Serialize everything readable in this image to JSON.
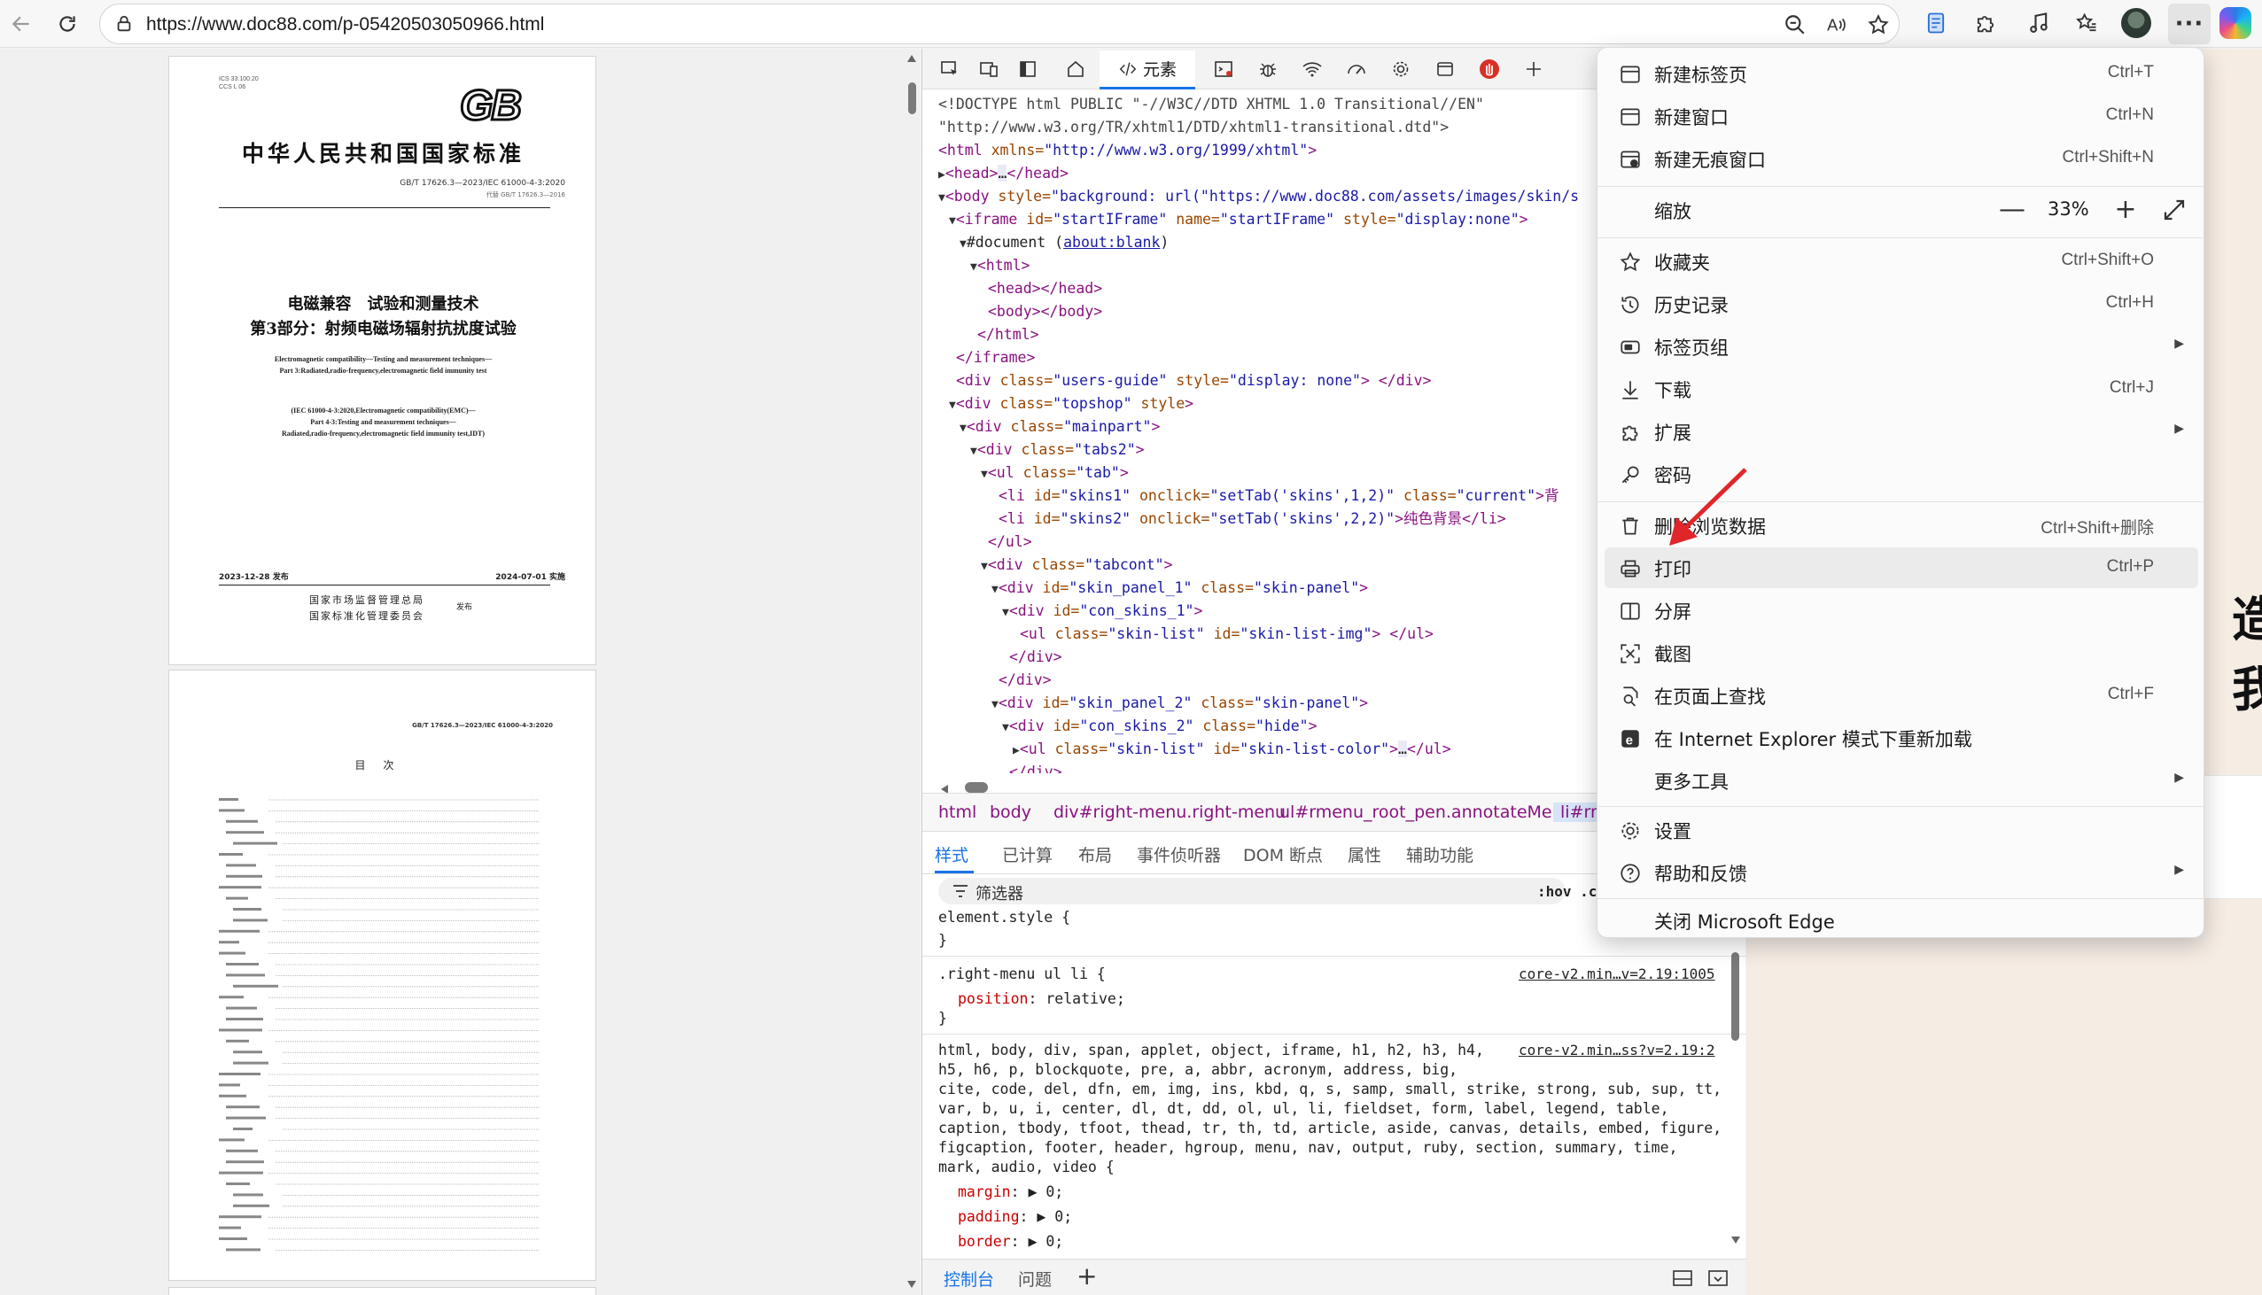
{
  "browser": {
    "url": "https://www.doc88.com/p-05420503050966.html"
  },
  "document": {
    "page1": {
      "ics_line": "ICS 33.100.20",
      "ccs_line": "CCS L 06",
      "logo": "GB",
      "nation": "中华人民共和国国家标准",
      "code": "GB/T 17626.3—2023/IEC 61000-4-3:2020",
      "replaces": "代替 GB/T 17626.3—2016",
      "title1": "电磁兼容　试验和测量技术",
      "title2": "第3部分：射频电磁场辐射抗扰度试验",
      "en1": "Electromagnetic compatibility—Testing and measurement techniques—",
      "en2": "Part 3:Radiated,radio-frequency,electromagnetic field immunity test",
      "en3": "(IEC 61000-4-3:2020,Electromagnetic compatibility(EMC)—",
      "en4": "Part 4-3:Testing and measurement techniques—",
      "en5": "Radiated,radio-frequency,electromagnetic field immunity test,IDT)",
      "pub_date": "2023-12-28 发布",
      "impl_date": "2024-07-01 实施",
      "pub_org1": "国家市场监督管理总局",
      "pub_org2": "国家标准化管理委员会",
      "pub_word": "发布"
    },
    "page2": {
      "code": "GB/T 17626.3—2023/IEC 61000-4-3:2020",
      "toc_title": "目次"
    }
  },
  "devtools": {
    "elements_tab": "元素",
    "tree": {
      "doctype1": "<!DOCTYPE html PUBLIC \"-//W3C//DTD XHTML 1.0 Transitional//EN\"",
      "doctype2": "\"http://www.w3.org/TR/xhtml1/DTD/xhtml1-transitional.dtd\">",
      "html_tag": "<html",
      "html_attr": " xmlns=",
      "html_val": "\"http://www.w3.org/1999/xhtml\"",
      "html_close": ">",
      "head_line": "<head>",
      "head_dots": "…",
      "head_close": "</head>",
      "body_tag": "<body",
      "body_attr": " style=",
      "body_val": "\"background: url(\"https://www.doc88.com/assets/images/skin/s",
      "iframe_tag": "<iframe",
      "iframe_a1": " id=",
      "iframe_v1": "\"startIFrame\"",
      "iframe_a2": " name=",
      "iframe_v2": "\"startIFrame\"",
      "iframe_a3": " style=",
      "iframe_v3": "\"display:none\"",
      "iframe_end": ">",
      "document_text": "#document (",
      "about_blank": "about:blank",
      "document_end": ")",
      "inner_html": "<html>",
      "inner_head": "<head></head>",
      "inner_body": "<body></body>",
      "inner_html_close": "</html>",
      "iframe_close": "</iframe>",
      "div1_tag": "<div",
      "div1_a": " class=",
      "div1_v": "\"users-guide\"",
      "div1_a2": " style=",
      "div1_v2": "\"display: none\"",
      "div1_end": "> </div>",
      "div2_tag": "<div",
      "div2_a": " class=",
      "div2_v": "\"topshop\"",
      "div2_a2": " style",
      "div2_end": ">",
      "div3_tag": "<div",
      "div3_a": " class=",
      "div3_v": "\"mainpart\"",
      "div3_end": ">",
      "div4_tag": "<div",
      "div4_a": " class=",
      "div4_v": "\"tabs2\"",
      "div4_end": ">",
      "ul_tag": "<ul",
      "ul_a": " class=",
      "ul_v": "\"tab\"",
      "ul_end": ">",
      "li1_tag": "<li",
      "li1_a1": " id=",
      "li1_v1": "\"skins1\"",
      "li1_a2": " onclick=",
      "li1_v2": "\"setTab('skins',1,2)\"",
      "li1_a3": " class=",
      "li1_v3": "\"current\"",
      "li1_end": ">背",
      "li2_tag": "<li",
      "li2_a1": " id=",
      "li2_v1": "\"skins2\"",
      "li2_a2": " onclick=",
      "li2_v2": "\"setTab('skins',2,2)\"",
      "li2_end": ">纯色背景</li>",
      "ul_close": "</ul>",
      "tabcont_tag": "<div",
      "tabcont_a": " class=",
      "tabcont_v": "\"tabcont\"",
      "tabcont_end": ">",
      "sp1_tag": "<div",
      "sp1_a1": " id=",
      "sp1_v1": "\"skin_panel_1\"",
      "sp1_a2": " class=",
      "sp1_v2": "\"skin-panel\"",
      "sp1_end": ">",
      "cs1_tag": "<div",
      "cs1_a1": " id=",
      "cs1_v1": "\"con_skins_1\"",
      "cs1_end": ">",
      "ul2_tag": "<ul",
      "ul2_a1": " class=",
      "ul2_v1": "\"skin-list\"",
      "ul2_a2": " id=",
      "ul2_v2": "\"skin-list-img\"",
      "ul2_end": "> </ul>",
      "div_close1": "</div>",
      "div_close2": "</div>",
      "sp2_tag": "<div",
      "sp2_a1": " id=",
      "sp2_v1": "\"skin_panel_2\"",
      "sp2_a2": " class=",
      "sp2_v2": "\"skin-panel\"",
      "sp2_end": ">",
      "cs2_tag": "<div",
      "cs2_a1": " id=",
      "cs2_v1": "\"con_skins_2\"",
      "cs2_a2": " class=",
      "cs2_v2": "\"hide\"",
      "cs2_end": ">",
      "ul3_tag": "<ul",
      "ul3_a1": " class=",
      "ul3_v1": "\"skin-list\"",
      "ul3_a2": " id=",
      "ul3_v2": "\"skin-list-color\"",
      "ul3_dots": "…",
      "ul3_end": "</ul>",
      "last_div": "</div>"
    },
    "breadcrumb": [
      "html",
      "body",
      "div#right-menu.right-menu",
      "ul#rmenu_root_pen.annotateMenu",
      "li#rm"
    ],
    "subtabs": [
      "样式",
      "已计算",
      "布局",
      "事件侦听器",
      "DOM 断点",
      "属性",
      "辅助功能"
    ],
    "filter_placeholder": "筛选器",
    "hov": ":hov .cls",
    "styles": {
      "r1_selector": "element.style {",
      "r1_close": "}",
      "r2_selector": ".right-menu ul li {",
      "r2_source": "core-v2.min…v=2.19:1005",
      "r2_prop": "position",
      "r2_value": ": relative;",
      "r2_close": "}",
      "r3_line1": "html, body, div, span, applet, object, iframe, h1, h2, h3, h4,",
      "r3_source": "core-v2.min…ss?v=2.19:2",
      "r3_line2": "h5, h6, p, blockquote, pre, a, abbr, acronym, address, big,",
      "r3_line3": "cite, code, del, dfn, em, img, ins, kbd, q, s, samp, small, strike, strong, sub, sup, tt,",
      "r3_line4": "var, b, u, i, center, dl, dt, dd, ol, ul, li, fieldset, form, label, legend, table,",
      "r3_line5": "caption, tbody, tfoot, thead, tr, th, td, article, aside, canvas, details, embed, figure,",
      "r3_line6": "figcaption, footer, header, hgroup, menu, nav, output, ruby, section, summary, time,",
      "r3_line7": "mark, audio, video {",
      "r3_p1": "margin",
      "r3_v1": ": ▶ 0;",
      "r3_p2": "padding",
      "r3_v2": ": ▶ 0;",
      "r3_p3": "border",
      "r3_v3": ": ▶ 0;"
    },
    "console_tabs": [
      "控制台",
      "问题"
    ],
    "console_add": "+"
  },
  "right_page": {
    "glyph": "造我"
  },
  "menu": {
    "items": [
      {
        "label": "新建标签页",
        "shortcut": "Ctrl+T"
      },
      {
        "label": "新建窗口",
        "shortcut": "Ctrl+N"
      },
      {
        "label": "新建无痕窗口",
        "shortcut": "Ctrl+Shift+N"
      },
      {
        "label": "缩放",
        "shortcut": ""
      },
      {
        "label": "收藏夹",
        "shortcut": "Ctrl+Shift+O"
      },
      {
        "label": "历史记录",
        "shortcut": "Ctrl+H"
      },
      {
        "label": "标签页组",
        "shortcut": ""
      },
      {
        "label": "下载",
        "shortcut": "Ctrl+J"
      },
      {
        "label": "扩展",
        "shortcut": ""
      },
      {
        "label": "密码",
        "shortcut": ""
      },
      {
        "label": "删除浏览数据",
        "shortcut": "Ctrl+Shift+删除"
      },
      {
        "label": "打印",
        "shortcut": "Ctrl+P"
      },
      {
        "label": "分屏",
        "shortcut": ""
      },
      {
        "label": "截图",
        "shortcut": ""
      },
      {
        "label": "在页面上查找",
        "shortcut": "Ctrl+F"
      },
      {
        "label": "在 Internet Explorer 模式下重新加载",
        "shortcut": ""
      },
      {
        "label": "更多工具",
        "shortcut": ""
      },
      {
        "label": "设置",
        "shortcut": ""
      },
      {
        "label": "帮助和反馈",
        "shortcut": ""
      },
      {
        "label": "关闭 Microsoft Edge",
        "shortcut": ""
      }
    ],
    "zoom_minus": "—",
    "zoom_value": "33%",
    "zoom_plus": "+"
  },
  "colors": {
    "accent": "#1a73e8",
    "arrow": "#e0262b",
    "tag": "#881280",
    "attr": "#994500",
    "value": "#1a1aa6"
  }
}
